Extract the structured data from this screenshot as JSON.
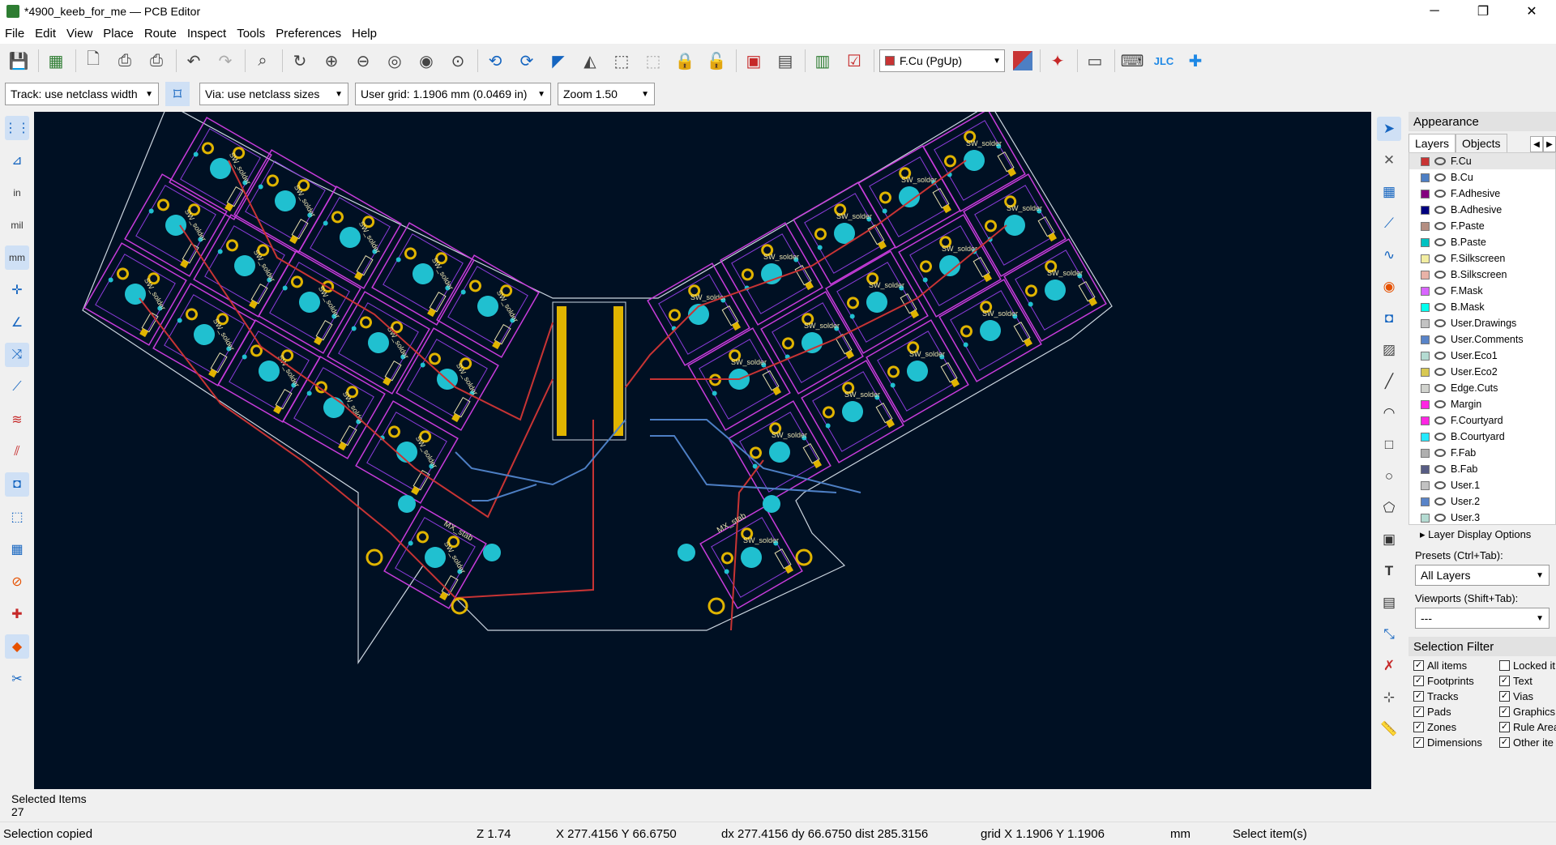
{
  "window": {
    "title": "*4900_keeb_for_me — PCB Editor",
    "minimize": "─",
    "maximize": "❐",
    "close": "✕"
  },
  "menu": [
    "File",
    "Edit",
    "View",
    "Place",
    "Route",
    "Inspect",
    "Tools",
    "Preferences",
    "Help"
  ],
  "toolbar": {
    "active_layer": "F.Cu (PgUp)"
  },
  "toolbar2": {
    "track": "Track: use netclass width",
    "via": "Via: use netclass sizes",
    "grid": "User grid: 1.1906 mm (0.0469 in)",
    "zoom": "Zoom 1.50"
  },
  "appearance": {
    "title": "Appearance",
    "tabs": [
      "Layers",
      "Objects"
    ],
    "layers": [
      {
        "name": "F.Cu",
        "color": "#c83434"
      },
      {
        "name": "B.Cu",
        "color": "#4d7fc4"
      },
      {
        "name": "F.Adhesive",
        "color": "#84007f"
      },
      {
        "name": "B.Adhesive",
        "color": "#00007f"
      },
      {
        "name": "F.Paste",
        "color": "#b48e82"
      },
      {
        "name": "B.Paste",
        "color": "#00c2c2"
      },
      {
        "name": "F.Silkscreen",
        "color": "#f2eda1"
      },
      {
        "name": "B.Silkscreen",
        "color": "#e8b2a7"
      },
      {
        "name": "F.Mask",
        "color": "#d864ff"
      },
      {
        "name": "B.Mask",
        "color": "#02ffee"
      },
      {
        "name": "User.Drawings",
        "color": "#c2c2c2"
      },
      {
        "name": "User.Comments",
        "color": "#5984c8"
      },
      {
        "name": "User.Eco1",
        "color": "#b4dbd2"
      },
      {
        "name": "User.Eco2",
        "color": "#d8c852"
      },
      {
        "name": "Edge.Cuts",
        "color": "#d0d2cd"
      },
      {
        "name": "Margin",
        "color": "#ff26e2"
      },
      {
        "name": "F.Courtyard",
        "color": "#ff26e2"
      },
      {
        "name": "B.Courtyard",
        "color": "#26e9ff"
      },
      {
        "name": "F.Fab",
        "color": "#afafaf"
      },
      {
        "name": "B.Fab",
        "color": "#585d84"
      },
      {
        "name": "User.1",
        "color": "#c2c2c2"
      },
      {
        "name": "User.2",
        "color": "#5984c8"
      },
      {
        "name": "User.3",
        "color": "#b4dbd2"
      }
    ],
    "layer_display_options": "Layer Display Options",
    "presets_label": "Presets (Ctrl+Tab):",
    "presets_value": "All Layers",
    "viewports_label": "Viewports (Shift+Tab):",
    "viewports_value": "---"
  },
  "selection_filter": {
    "title": "Selection Filter",
    "items": [
      {
        "label": "All items",
        "checked": true
      },
      {
        "label": "Locked it",
        "checked": false
      },
      {
        "label": "Footprints",
        "checked": true
      },
      {
        "label": "Text",
        "checked": true
      },
      {
        "label": "Tracks",
        "checked": true
      },
      {
        "label": "Vias",
        "checked": true
      },
      {
        "label": "Pads",
        "checked": true
      },
      {
        "label": "Graphics",
        "checked": true
      },
      {
        "label": "Zones",
        "checked": true
      },
      {
        "label": "Rule Area",
        "checked": true
      },
      {
        "label": "Dimensions",
        "checked": true
      },
      {
        "label": "Other ite",
        "checked": true
      }
    ]
  },
  "bottom": {
    "selected_label": "Selected Items",
    "selected_count": "27"
  },
  "status": {
    "message": "Selection copied",
    "zoom": "Z 1.74",
    "coords": "X 277.4156  Y 66.6750",
    "delta": "dx 277.4156  dy 66.6750  dist 285.3156",
    "grid": "grid X 1.1906  Y 1.1906",
    "units": "mm",
    "mode": "Select item(s)"
  },
  "pcb": {
    "footprint_label": "SW_solder",
    "stab_label": "MX_stab"
  }
}
